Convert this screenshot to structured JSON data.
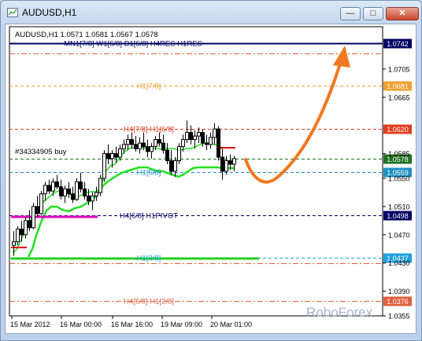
{
  "window": {
    "title": "AUDUSD,H1",
    "minimize_symbol": "—",
    "maximize_symbol": "□",
    "close_symbol": "✕"
  },
  "header": {
    "symbol": "AUDUSD,H1",
    "ohlc": "1.0571 1.0581 1.0567 1.0578"
  },
  "watermark": "RoboForex",
  "order_label": "#34334905 buy",
  "colors": {
    "bg": "#ffffff",
    "frame": "#b9d1ea",
    "accent_orange": "#f07820",
    "green": "#20e020",
    "magenta": "#e000c0",
    "navy": "#000060"
  },
  "chart_data": {
    "type": "candlestick",
    "symbol": "AUDUSD",
    "timeframe": "H1",
    "ylim": [
      1.0355,
      1.0765
    ],
    "price_ticks": [
      "1.0705",
      "1.0665",
      "1.0585",
      "1.0550",
      "1.0510",
      "1.0470",
      "1.0430",
      "1.0390",
      "1.0355"
    ],
    "time_ticks": [
      "15 Mar 2012",
      "16 Mar 00:00",
      "16 Mar 16:00",
      "19 Mar 09:00",
      "20 Mar 01:00"
    ],
    "levels": [
      {
        "label": "MN1[7/8] W1[6/8] D1[6/8] H4RES H1RES",
        "price": 1.0742,
        "tag": "1.0742",
        "color": "#000060",
        "style": "solid"
      },
      {
        "label": "",
        "price": 1.0727,
        "tag": "",
        "color": "#e06040",
        "style": "dashdot"
      },
      {
        "label": "H1[7/8]",
        "price": 1.0681,
        "tag": "1.0681",
        "color": "#f0a030",
        "style": "dash"
      },
      {
        "label": "H4[7/8] H1[6/8]",
        "price": 1.062,
        "tag": "1.0620",
        "color": "#e04020",
        "style": "dash"
      },
      {
        "label": "",
        "price": 1.0578,
        "tag": "1.0578",
        "color": "#207020",
        "style": "dash"
      },
      {
        "label": "H1[5/8]",
        "price": 1.0559,
        "tag": "1.0559",
        "color": "#2090c0",
        "style": "dash"
      },
      {
        "label": "H4[6/8] H1PIVOT",
        "price": 1.0498,
        "tag": "1.0498",
        "color": "#000060",
        "style": "dash"
      },
      {
        "label": "H1[3/8]",
        "price": 1.0437,
        "tag": "1.0437",
        "color": "#20a0e0",
        "style": "dash"
      },
      {
        "label": "",
        "price": 1.043,
        "tag": "",
        "color": "#e06040",
        "style": "dashdot"
      },
      {
        "label": "H4[5/8] H1[2/8]",
        "price": 1.0376,
        "tag": "1.0376",
        "color": "#e06040",
        "style": "dashdot"
      }
    ],
    "candles": [
      [
        1.0455,
        1.0475,
        1.044,
        1.046
      ],
      [
        1.046,
        1.0482,
        1.0455,
        1.0478
      ],
      [
        1.0478,
        1.049,
        1.046,
        1.047
      ],
      [
        1.047,
        1.0495,
        1.0465,
        1.049
      ],
      [
        1.049,
        1.0505,
        1.0475,
        1.048
      ],
      [
        1.048,
        1.0515,
        1.0478,
        1.051
      ],
      [
        1.051,
        1.0525,
        1.0495,
        1.05
      ],
      [
        1.05,
        1.0532,
        1.0498,
        1.0528
      ],
      [
        1.0528,
        1.0545,
        1.0518,
        1.054
      ],
      [
        1.054,
        1.0548,
        1.0528,
        1.0532
      ],
      [
        1.0532,
        1.055,
        1.0525,
        1.0545
      ],
      [
        1.0545,
        1.0555,
        1.0535,
        1.0538
      ],
      [
        1.0538,
        1.0548,
        1.052,
        1.0525
      ],
      [
        1.0525,
        1.054,
        1.0515,
        1.0535
      ],
      [
        1.0535,
        1.0545,
        1.0522,
        1.0528
      ],
      [
        1.0528,
        1.0538,
        1.0515,
        1.052
      ],
      [
        1.052,
        1.055,
        1.0518,
        1.0545
      ],
      [
        1.0545,
        1.0558,
        1.053,
        1.0535
      ],
      [
        1.0535,
        1.0545,
        1.052,
        1.0525
      ],
      [
        1.0525,
        1.0535,
        1.0512,
        1.0518
      ],
      [
        1.0518,
        1.053,
        1.0505,
        1.0525
      ],
      [
        1.0525,
        1.0538,
        1.0518,
        1.053
      ],
      [
        1.053,
        1.0555,
        1.0525,
        1.055
      ],
      [
        1.055,
        1.059,
        1.0545,
        1.0585
      ],
      [
        1.0585,
        1.0598,
        1.057,
        1.0578
      ],
      [
        1.0578,
        1.059,
        1.0565,
        1.0585
      ],
      [
        1.0585,
        1.0595,
        1.0572,
        1.058
      ],
      [
        1.058,
        1.0598,
        1.0575,
        1.0592
      ],
      [
        1.0592,
        1.0605,
        1.0585,
        1.0598
      ],
      [
        1.0598,
        1.0612,
        1.059,
        1.0605
      ],
      [
        1.0605,
        1.0615,
        1.0592,
        1.0598
      ],
      [
        1.0598,
        1.061,
        1.0588,
        1.0592
      ],
      [
        1.0592,
        1.0608,
        1.0585,
        1.06
      ],
      [
        1.06,
        1.0615,
        1.059,
        1.0595
      ],
      [
        1.0595,
        1.0605,
        1.058,
        1.0588
      ],
      [
        1.0588,
        1.06,
        1.0578,
        1.0595
      ],
      [
        1.0595,
        1.061,
        1.059,
        1.0605
      ],
      [
        1.0605,
        1.0615,
        1.0595,
        1.06
      ],
      [
        1.06,
        1.0612,
        1.0585,
        1.059
      ],
      [
        1.059,
        1.06,
        1.057,
        1.0575
      ],
      [
        1.0575,
        1.059,
        1.0555,
        1.056
      ],
      [
        1.056,
        1.058,
        1.0552,
        1.0575
      ],
      [
        1.0575,
        1.06,
        1.057,
        1.0595
      ],
      [
        1.0595,
        1.0612,
        1.0588,
        1.0605
      ],
      [
        1.0605,
        1.0632,
        1.06,
        1.0615
      ],
      [
        1.0615,
        1.0625,
        1.0598,
        1.0605
      ],
      [
        1.0605,
        1.0618,
        1.0592,
        1.061
      ],
      [
        1.061,
        1.0622,
        1.06,
        1.0615
      ],
      [
        1.0615,
        1.062,
        1.0595,
        1.06
      ],
      [
        1.06,
        1.0612,
        1.059,
        1.0598
      ],
      [
        1.0598,
        1.0615,
        1.0592,
        1.0608
      ],
      [
        1.0608,
        1.0628,
        1.0598,
        1.062
      ],
      [
        1.062,
        1.0624,
        1.0575,
        1.058
      ],
      [
        1.058,
        1.0592,
        1.0548,
        1.056
      ],
      [
        1.056,
        1.0582,
        1.0555,
        1.0575
      ],
      [
        1.0575,
        1.0584,
        1.0562,
        1.057
      ],
      [
        1.057,
        1.0582,
        1.056,
        1.0578
      ]
    ]
  }
}
